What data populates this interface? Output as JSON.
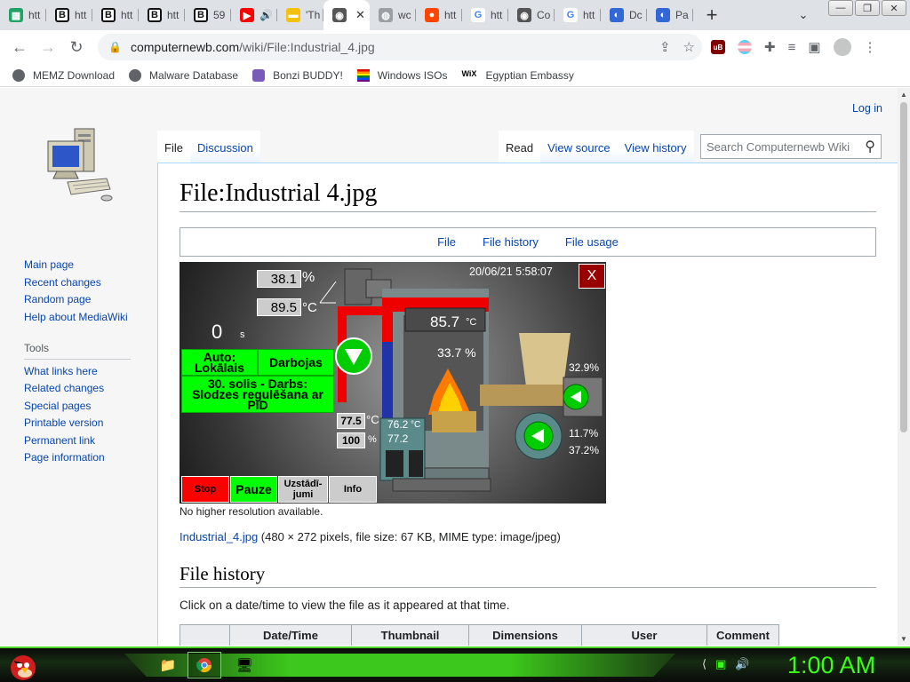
{
  "tabs": [
    {
      "icon": "sheet",
      "color": "#21a366",
      "glyph": "▦",
      "label": "htt"
    },
    {
      "icon": "b",
      "color": "#111",
      "glyph": "B",
      "label": "htt"
    },
    {
      "icon": "b",
      "color": "#111",
      "glyph": "B",
      "label": "htt"
    },
    {
      "icon": "b",
      "color": "#111",
      "glyph": "B",
      "label": "htt"
    },
    {
      "icon": "b",
      "color": "#111",
      "glyph": "B",
      "label": "59"
    },
    {
      "icon": "youtube",
      "color": "#ff0000",
      "glyph": "▶",
      "label": "🔊"
    },
    {
      "icon": "film",
      "color": "#f4c20d",
      "glyph": "▬",
      "label": "'Th"
    },
    {
      "icon": "cwiki",
      "color": "#555",
      "glyph": "◉",
      "label": "✕",
      "active": true
    },
    {
      "icon": "globe",
      "color": "#9aa0a6",
      "glyph": "◍",
      "label": "wc"
    },
    {
      "icon": "reddit",
      "color": "#ff4500",
      "glyph": "●",
      "label": "htt"
    },
    {
      "icon": "google",
      "color": "#fff",
      "glyph": "G",
      "label": "htt"
    },
    {
      "icon": "cwiki",
      "color": "#555",
      "glyph": "◉",
      "label": "Co"
    },
    {
      "icon": "google",
      "color": "#fff",
      "glyph": "G",
      "label": "htt"
    },
    {
      "icon": "compass",
      "color": "#3367d6",
      "glyph": "◐",
      "label": "Dc"
    },
    {
      "icon": "compass",
      "color": "#3367d6",
      "glyph": "◐",
      "label": "Pa"
    }
  ],
  "browser": {
    "url_domain": "computernewb.com",
    "url_path": "/wiki/File:Industrial_4.jpg",
    "new_tab": "+",
    "window_buttons": [
      "—",
      "❐",
      "✕"
    ]
  },
  "bookmarks": [
    {
      "icon": "globe",
      "label": "MEMZ Download"
    },
    {
      "icon": "globe",
      "label": "Malware Database"
    },
    {
      "icon": "bonzi",
      "label": "Bonzi BUDDY!"
    },
    {
      "icon": "rainbow",
      "label": "Windows ISOs"
    },
    {
      "icon": "wix",
      "label": "Egyptian Embassy"
    }
  ],
  "wiki": {
    "login": "Log in",
    "left_tabs": [
      "File",
      "Discussion"
    ],
    "right_tabs": [
      "Read",
      "View source",
      "View history"
    ],
    "search_placeholder": "Search Computernewb Wiki",
    "title": "File:Industrial 4.jpg",
    "file_toc": [
      "File",
      "File history",
      "File usage"
    ],
    "nav": [
      "Main page",
      "Recent changes",
      "Random page",
      "Help about MediaWiki"
    ],
    "tools_heading": "Tools",
    "tools": [
      "What links here",
      "Related changes",
      "Special pages",
      "Printable version",
      "Permanent link",
      "Page information"
    ],
    "caption": "No higher resolution available.",
    "file_link": "Industrial_4.jpg",
    "file_meta": " (480 × 272 pixels, file size: 67 KB, MIME type: image/jpeg)",
    "history_heading": "File history",
    "history_hint": "Click on a date/time to view the file as it appeared at that time.",
    "history_cols": [
      "",
      "Date/Time",
      "Thumbnail",
      "Dimensions",
      "User",
      "Comment"
    ]
  },
  "hmi": {
    "timestamp": "20/06/21 5:58:07",
    "close": "X",
    "val1": "38.1",
    "unit1": "%",
    "val2": "89.5",
    "unit2": "°C",
    "counter": "0",
    "counter_unit": "s",
    "mode": "Auto:\nLokālais",
    "state": "Darbojas",
    "step": "30. solis - Darbs:\nSlodzes regulēšana ar PID",
    "val3": "77.5",
    "unit3": "°C",
    "val4": "100",
    "unit4": "%",
    "chimney_temp": "85.7",
    "chimney_unit": "°C",
    "chamber_pct": "33.7 %",
    "water1": "76.2",
    "water2": "77.2",
    "water_unit": "°C",
    "right1": "32.9%",
    "right2": "11.7%",
    "right3": "37.2%",
    "btn_stop": "Stop",
    "btn_pause": "Pauze",
    "btn_settings": "Uzstādī-\njumi",
    "btn_info": "Info"
  },
  "taskbar": {
    "clock": "1:00 AM",
    "apps": [
      "folder",
      "chrome",
      "vm"
    ]
  }
}
